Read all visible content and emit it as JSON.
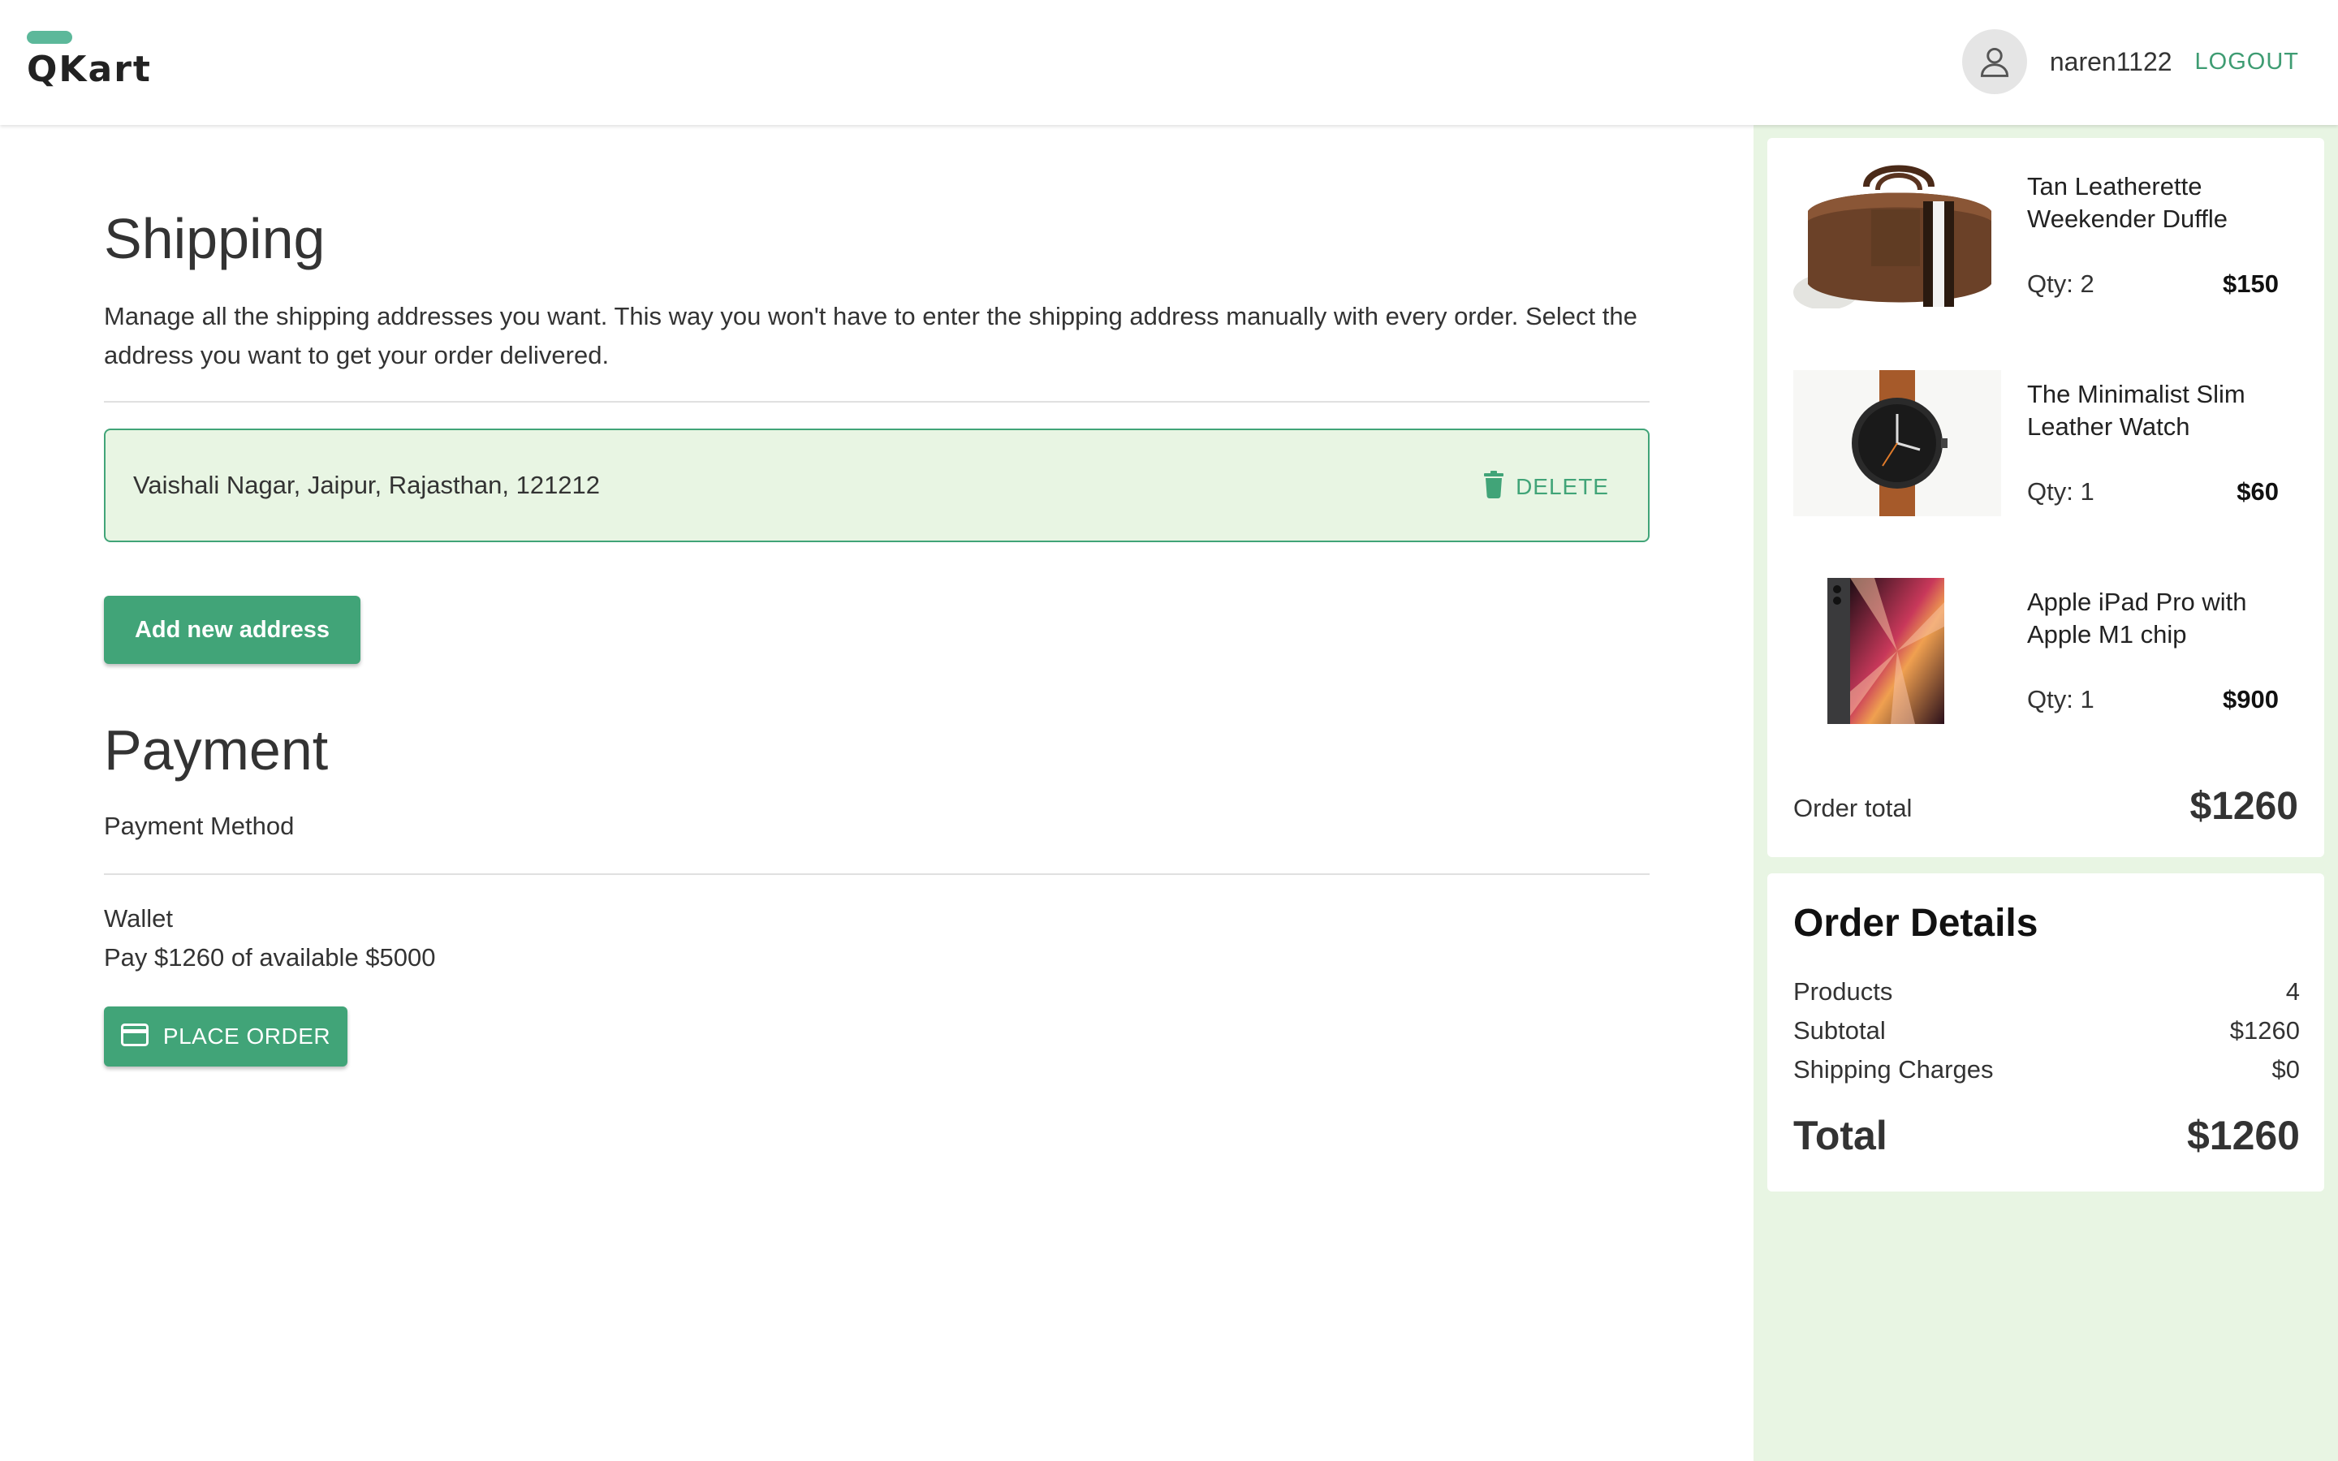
{
  "header": {
    "logo_text": "QKart",
    "username": "naren1122",
    "logout_label": "LOGOUT"
  },
  "shipping": {
    "title": "Shipping",
    "description": "Manage all the shipping addresses you want. This way you won't have to enter the shipping address manually with every order. Select the address you want to get your order delivered.",
    "addresses": [
      {
        "text": "Vaishali Nagar, Jaipur, Rajasthan, 121212",
        "delete_label": "DELETE"
      }
    ],
    "add_button_label": "Add new address"
  },
  "payment": {
    "title": "Payment",
    "method_label": "Payment Method",
    "wallet_label": "Wallet",
    "wallet_info": "Pay $1260 of available $5000",
    "place_order_label": "PLACE ORDER"
  },
  "cart": {
    "items": [
      {
        "name": "Tan Leatherette Weekender Duffle",
        "qty": "Qty: 2",
        "price": "$150",
        "image": "duffle-bag"
      },
      {
        "name": "The Minimalist Slim Leather Watch",
        "qty": "Qty: 1",
        "price": "$60",
        "image": "watch"
      },
      {
        "name": "Apple iPad Pro with Apple M1 chip",
        "qty": "Qty: 1",
        "price": "$900",
        "image": "ipad"
      }
    ],
    "order_total_label": "Order total",
    "order_total_value": "$1260"
  },
  "order_details": {
    "title": "Order Details",
    "rows": [
      {
        "label": "Products",
        "value": "4"
      },
      {
        "label": "Subtotal",
        "value": "$1260"
      },
      {
        "label": "Shipping Charges",
        "value": "$0"
      }
    ],
    "total_label": "Total",
    "total_value": "$1260"
  },
  "colors": {
    "primary": "#41a478",
    "sidebar_bg": "#e8f5e3",
    "address_bg": "#e8f5e3"
  }
}
